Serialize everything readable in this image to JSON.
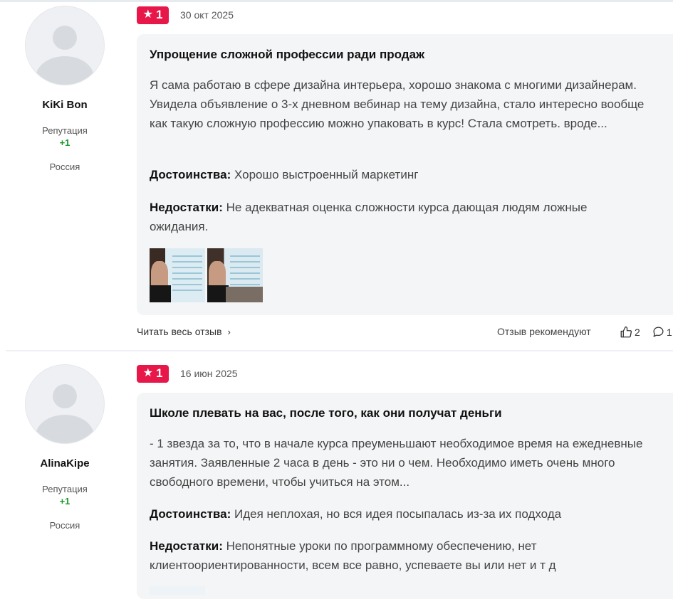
{
  "reviews": [
    {
      "author": {
        "name": "KiKi Bon",
        "reputation_label": "Репутация",
        "reputation_value": "+1",
        "country": "Россия"
      },
      "rating": "1",
      "date": "30 окт 2025",
      "title": "Упрощение сложной профессии ради продаж",
      "text": "Я сама работаю в сфере дизайна интерьера, хорошо знакома с многими дизайнерам. Увидела объявление о 3-х дневном вебинар на тему дизайна, стало интересно вообще как такую сложную профессию можно упаковать в курс! Стала смотреть. вроде...",
      "pros_label": "Достоинства:",
      "pros": "Хорошо выстроенный маркетинг",
      "cons_label": "Недостатки:",
      "cons": "Не адекватная оценка сложности курса дающая людям ложные ожидания.",
      "read_more": "Читать весь отзыв",
      "recommend_label": "Отзыв рекомендуют",
      "likes": "2",
      "comments": "1"
    },
    {
      "author": {
        "name": "AlinaKipe",
        "reputation_label": "Репутация",
        "reputation_value": "+1",
        "country": "Россия"
      },
      "rating": "1",
      "date": "16 июн 2025",
      "title": "Школе плевать на вас, после того, как они получат деньги",
      "text": "- 1 звезда за то, что в начале курса преуменьшают необходимое время на ежедневные занятия. Заявленные 2 часа в день - это ни о чем. Необходимо иметь очень много свободного времени, чтобы учиться на этом...",
      "pros_label": "Достоинства:",
      "pros": "Идея неплохая, но вся идея посыпалась из-за их подхода",
      "cons_label": "Недостатки:",
      "cons": "Непонятные уроки по программному обеспечению, нет клиентоориентированности, всем все равно, успеваете вы или нет и т д"
    }
  ],
  "icons": {
    "star": "star-icon",
    "chevron": "chevron-right-icon",
    "like": "thumbs-up-icon",
    "comment": "comment-icon"
  },
  "colors": {
    "badge": "#e8174a",
    "reputation": "#1a9a2a",
    "card_bg": "#f4f5f7"
  }
}
